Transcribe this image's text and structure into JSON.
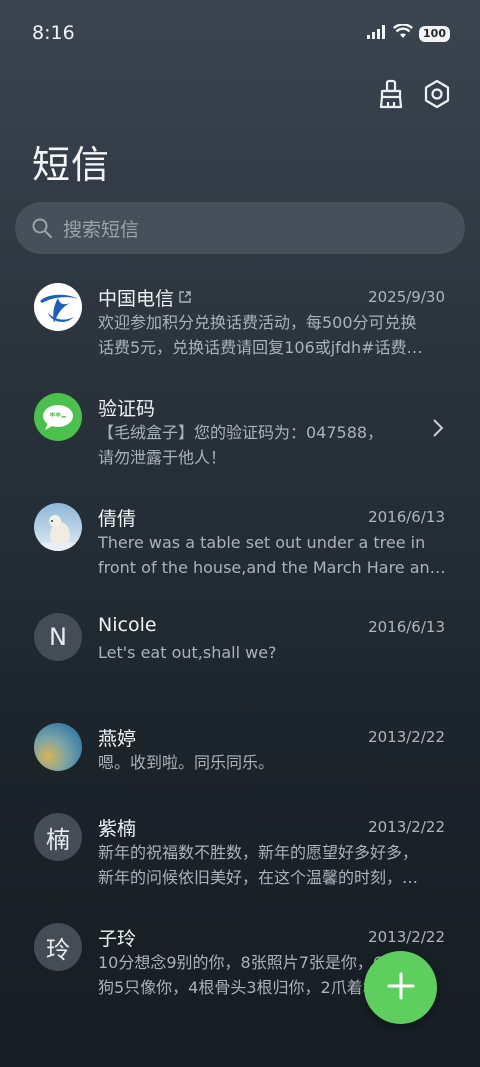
{
  "status": {
    "time": "8:16",
    "battery": "100"
  },
  "header": {
    "title": "短信"
  },
  "search": {
    "placeholder": "搜索短信"
  },
  "messages": [
    {
      "name": "中国电信",
      "date": "2025/9/30",
      "line1": "欢迎参加积分兑换话费活动，每500分可兑换",
      "line2": "话费5元，兑换话费请回复106或jfdh#话费…"
    },
    {
      "name": "验证码",
      "date": "",
      "line1": "【毛绒盒子】您的验证码为：047588，",
      "line2": "请勿泄露于他人！"
    },
    {
      "name": "倩倩",
      "date": "2016/6/13",
      "line1": "There was a table set out under a tree in",
      "line2": "front of the house,and the March Hare an…"
    },
    {
      "name": "Nicole",
      "avatar_letter": "N",
      "date": "2016/6/13",
      "line1": "Let's eat out,shall we?",
      "line2": ""
    },
    {
      "name": "燕婷",
      "date": "2013/2/22",
      "line1": "嗯。收到啦。同乐同乐。",
      "line2": ""
    },
    {
      "name": "紫楠",
      "avatar_letter": "楠",
      "date": "2013/2/22",
      "line1": "新年的祝福数不胜数，新年的愿望好多好多，",
      "line2": "新年的问候依旧美好，在这个温馨的时刻，…"
    },
    {
      "name": "子玲",
      "avatar_letter": "玲",
      "date": "2013/2/22",
      "line1": "10分想念9别的你，8张照片7张是你，6只小",
      "line2": "狗5只像你，4根骨头3根归你，2爪着地1宗…"
    }
  ],
  "colors": {
    "fab": "#5ecf5e",
    "telecom_blue": "#1c5fb8",
    "chat_green": "#4cc04c"
  }
}
